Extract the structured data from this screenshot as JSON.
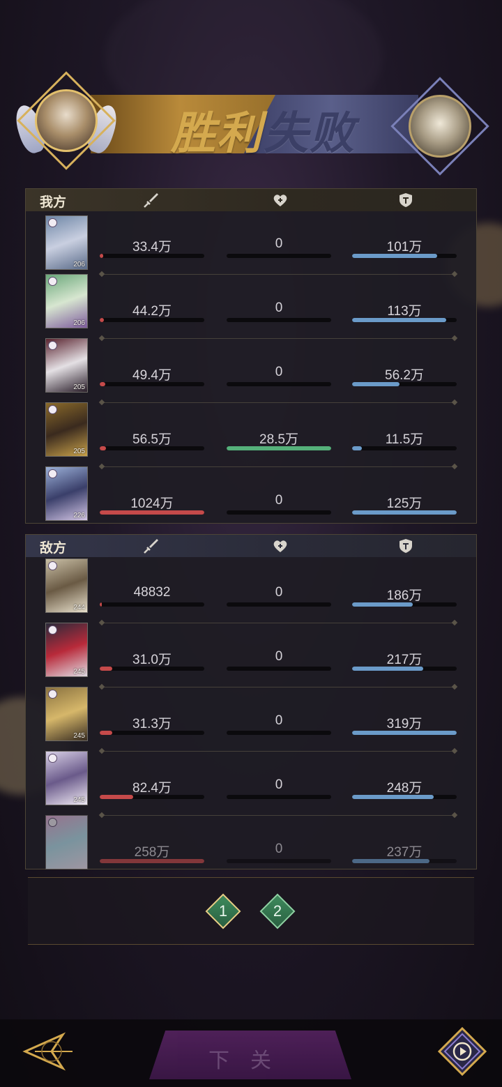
{
  "result": {
    "win_label": "胜利",
    "lose_label": "失败"
  },
  "columns": {
    "attack_icon": "sword-icon",
    "heal_icon": "heart-icon",
    "defense_icon": "shield-icon"
  },
  "colors": {
    "damage": "#c54a4a",
    "heal": "#55b07a",
    "taken": "#6b9bc9"
  },
  "ally": {
    "title": "我方",
    "rows": [
      {
        "level": "206",
        "damage": "33.4万",
        "damage_pct": 0.03,
        "heal": "0",
        "heal_pct": 0,
        "taken": "101万",
        "taken_pct": 0.81
      },
      {
        "level": "206",
        "damage": "44.2万",
        "damage_pct": 0.04,
        "heal": "0",
        "heal_pct": 0,
        "taken": "113万",
        "taken_pct": 0.9
      },
      {
        "level": "205",
        "damage": "49.4万",
        "damage_pct": 0.05,
        "heal": "0",
        "heal_pct": 0,
        "taken": "56.2万",
        "taken_pct": 0.45
      },
      {
        "level": "205",
        "damage": "56.5万",
        "damage_pct": 0.06,
        "heal": "28.5万",
        "heal_pct": 1.0,
        "taken": "11.5万",
        "taken_pct": 0.09
      },
      {
        "level": "226",
        "damage": "1024万",
        "damage_pct": 1.0,
        "heal": "0",
        "heal_pct": 0,
        "taken": "125万",
        "taken_pct": 1.0
      }
    ]
  },
  "enemy": {
    "title": "敌方",
    "rows": [
      {
        "level": "244",
        "damage": "48832",
        "damage_pct": 0.02,
        "heal": "0",
        "heal_pct": 0,
        "taken": "186万",
        "taken_pct": 0.58
      },
      {
        "level": "245",
        "damage": "31.0万",
        "damage_pct": 0.12,
        "heal": "0",
        "heal_pct": 0,
        "taken": "217万",
        "taken_pct": 0.68
      },
      {
        "level": "245",
        "damage": "31.3万",
        "damage_pct": 0.12,
        "heal": "0",
        "heal_pct": 0,
        "taken": "319万",
        "taken_pct": 1.0
      },
      {
        "level": "245",
        "damage": "82.4万",
        "damage_pct": 0.32,
        "heal": "0",
        "heal_pct": 0,
        "taken": "248万",
        "taken_pct": 0.78
      },
      {
        "level": "",
        "damage": "258万",
        "damage_pct": 1.0,
        "heal": "0",
        "heal_pct": 0,
        "taken": "237万",
        "taken_pct": 0.74
      }
    ]
  },
  "pager": {
    "pages": [
      "1",
      "2"
    ],
    "active": 0
  },
  "bottom": {
    "next_label": "下关"
  }
}
